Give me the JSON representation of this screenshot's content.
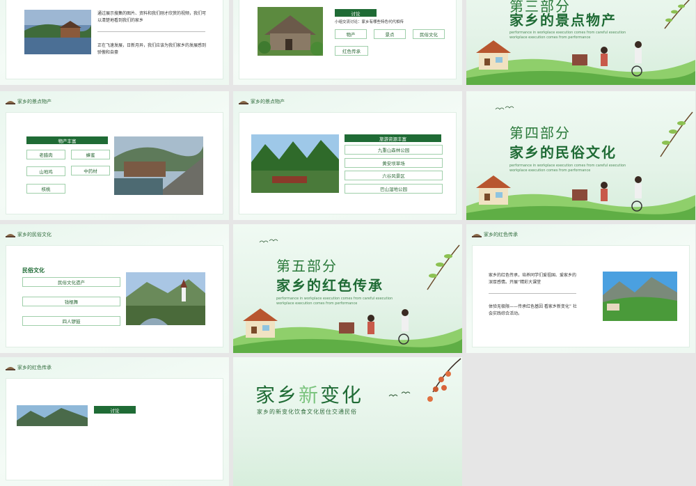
{
  "s1": {
    "p1": "通过展示搜集的图片、资料和我们刚才欣赏的视频，我们可以清楚地看到我们的家乡",
    "p2": "正在飞速发展，日新月异，我们应该为我们家乡的发展感到骄傲和自豪"
  },
  "s2": {
    "discuss": "讨论",
    "prompt": "小组交流讨论：家乡有哪些特色代代相传",
    "tags": [
      "物产",
      "景点",
      "民俗文化",
      "红色传承"
    ]
  },
  "s3": {
    "num": "第三部分",
    "title": "家乡的景点物产",
    "sub": "performance in workplace execution comes from careful execution workplace execution comes from performance"
  },
  "s4": {
    "header": "家乡的景点物产",
    "box": "物产丰富",
    "items": [
      "老腊肉",
      "蜂蜜",
      "山地鸡",
      "中药材",
      "核桃"
    ]
  },
  "s5": {
    "header": "家乡的景点物产",
    "box": "旅游资源丰富",
    "items": [
      "九重山森林公园",
      "黄安坝草场",
      "六谷风景区",
      "巴山湿地公园"
    ]
  },
  "s6": {
    "num": "第四部分",
    "title": "家乡的民俗文化",
    "sub": "performance in workplace execution comes from careful execution workplace execution comes from performance"
  },
  "s7": {
    "header": "家乡的民俗文化",
    "title": "民俗文化",
    "items": [
      "民俗文化遗产",
      "钱棍舞",
      "四人锣鼓"
    ]
  },
  "s8": {
    "num": "第五部分",
    "title": "家乡的红色传承",
    "sub": "performance in workplace execution comes from careful execution workplace execution comes from performance"
  },
  "s9": {
    "header": "家乡的红色传承",
    "p1": "家乡的红色传承，培养同学们爱祖国、爱家乡的深厚感情。开展“精彩大课堂",
    "p2": "体验无极限——传承红色基因 看家乡新变化” 社会实践综合活动。"
  },
  "s10": {
    "header": "家乡的红色传承",
    "discuss": "讨论"
  },
  "s11": {
    "title_a": "家乡",
    "title_b": "新",
    "title_c": "变化",
    "sub": "家乡的新变化饮食文化居住交通民俗"
  },
  "colors": {
    "brand": "#1f6b35",
    "accent": "#7cc47f",
    "bg": "#e6e6e6"
  }
}
